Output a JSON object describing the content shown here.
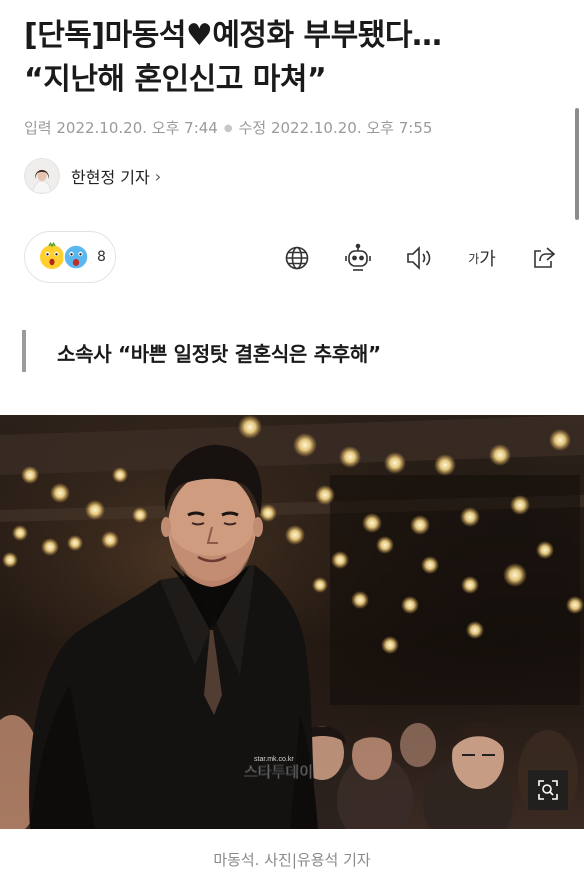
{
  "article": {
    "title_line1": "[단독]마동석♥예정화 부부됐다…",
    "title_line2": "“지난해 혼인신고 마쳐”",
    "published": "입력 2022.10.20. 오후 7:44",
    "modified": "수정 2022.10.20. 오후 7:55",
    "author": "한현정 기자",
    "author_chevron": "›",
    "subheading": "소속사 “바쁜 일정탓 결혼식은 추후해”",
    "photo_caption": "마동석. 사진|유용석 기자",
    "watermark_url": "star.mk.co.kr",
    "watermark_brand": "스타투데이"
  },
  "toolbar": {
    "reaction_count": "8",
    "font_size_label_small": "가",
    "font_size_label_large": "가"
  },
  "icons": {
    "reaction": "reaction-emoji-icon",
    "language": "globe-icon",
    "summary": "robot-icon",
    "listen": "speaker-icon",
    "share": "share-icon",
    "zoom": "zoom-icon"
  },
  "colors": {
    "title": "#1a1a1a",
    "meta": "#9a9a9a",
    "quote_bar": "#9b9b9b",
    "caption": "#8a8a8a"
  }
}
